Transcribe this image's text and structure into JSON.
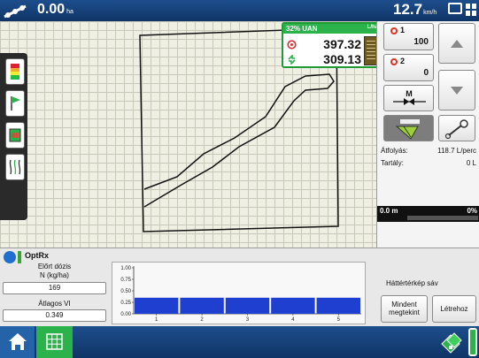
{
  "topbar": {
    "area_value": "0.00",
    "area_unit": "ha",
    "speed_value": "12.7",
    "speed_unit": "km/h"
  },
  "product": {
    "name": "32% UAN",
    "unit": "L/ha",
    "target_rate": "397.32",
    "actual_rate": "309.13",
    "colors": {
      "accent": "#2bb24a",
      "target_icon": "#d32f2f"
    }
  },
  "sections": [
    {
      "id": "1",
      "value": "100"
    },
    {
      "id": "2",
      "value": "0"
    }
  ],
  "rate_buttons": {
    "up": "arrow-up-icon",
    "down": "arrow-down-icon",
    "master_label": "M"
  },
  "flow": {
    "label": "Átfolyás:",
    "value": "118.7 L/perc"
  },
  "tank": {
    "label": "Tartály:",
    "value": "0 L"
  },
  "progress": {
    "distance": "0.0 m",
    "percent_label": "0%",
    "percent": 0
  },
  "optrx": {
    "title": "OptRx",
    "prev_dose_label_1": "Előrt dózis",
    "prev_dose_label_2": "N (kg/ha)",
    "prev_dose_value": "169",
    "avg_vi_label": "Átlagos VI",
    "avg_vi_value": "0.349"
  },
  "chart_data": {
    "type": "bar",
    "categories": [
      "1",
      "2",
      "3",
      "4",
      "5"
    ],
    "values": [
      0.35,
      0.35,
      0.35,
      0.35,
      0.35
    ],
    "y_ticks": [
      "1.00",
      "0.75",
      "0.50",
      "0.25",
      "0.00"
    ],
    "ylim": [
      0,
      1
    ],
    "title": "",
    "xlabel": "",
    "ylabel": "",
    "bar_color": "#1f3fd0"
  },
  "background_panel": {
    "label": "Háttértérkép sáv",
    "view_all_label_1": "Mindent",
    "view_all_label_2": "megtekint",
    "create_label": "Létrehoz"
  },
  "taskbar": {
    "home": "home-icon",
    "grid": "grid-icon"
  }
}
